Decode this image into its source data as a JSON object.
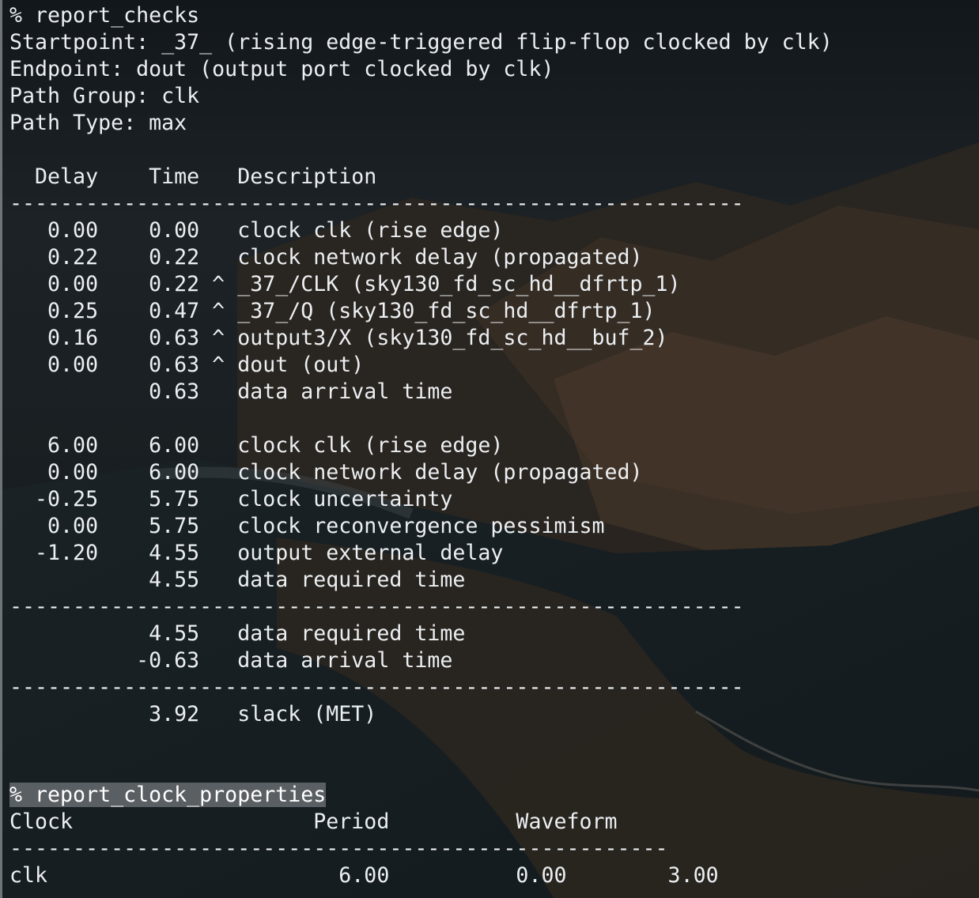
{
  "terminal": {
    "lines": [
      "% report_checks",
      "Startpoint: _37_ (rising edge-triggered flip-flop clocked by clk)",
      "Endpoint: dout (output port clocked by clk)",
      "Path Group: clk",
      "Path Type: max",
      "",
      "  Delay    Time   Description",
      "----------------------------------------------------------",
      "   0.00    0.00   clock clk (rise edge)",
      "   0.22    0.22   clock network delay (propagated)",
      "   0.00    0.22 ^ _37_/CLK (sky130_fd_sc_hd__dfrtp_1)",
      "   0.25    0.47 ^ _37_/Q (sky130_fd_sc_hd__dfrtp_1)",
      "   0.16    0.63 ^ output3/X (sky130_fd_sc_hd__buf_2)",
      "   0.00    0.63 ^ dout (out)",
      "           0.63   data arrival time",
      "",
      "   6.00    6.00   clock clk (rise edge)",
      "   0.00    6.00   clock network delay (propagated)",
      "  -0.25    5.75   clock uncertainty",
      "   0.00    5.75   clock reconvergence pessimism",
      "  -1.20    4.55   output external delay",
      "           4.55   data required time",
      "----------------------------------------------------------",
      "           4.55   data required time",
      "          -0.63   data arrival time",
      "----------------------------------------------------------",
      "           3.92   slack (MET)",
      "",
      "",
      "% report_clock_properties",
      "Clock                   Period          Waveform",
      "----------------------------------------------------",
      "clk                       6.00          0.00        3.00"
    ],
    "highlighted_line_index": 29
  },
  "colors": {
    "text": "#eceff2",
    "background": "#151a1d",
    "highlight": "#5a5f64"
  }
}
